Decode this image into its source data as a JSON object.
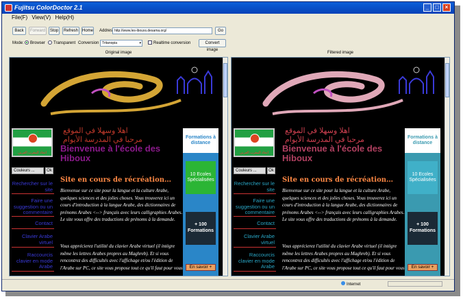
{
  "window": {
    "title": "Fujitsu ColorDoctor 2.1"
  },
  "menu": [
    "File(F)",
    "View(V)",
    "Help(H)"
  ],
  "toolbar": {
    "back": "Back",
    "forward": "Forward",
    "stop": "Stop",
    "refresh": "Refresh",
    "home": "Home",
    "address_label": "Address:",
    "address_value": "http://www.les-ibouxs.desama.org/",
    "go": "Go"
  },
  "options": {
    "mode_label": "Mode:",
    "mode_browser": "Browser",
    "mode_transparent": "Transparent",
    "filter_label": "Conversion filter:",
    "filter_value": "Tritanopia",
    "realtime": "Realtime conversion",
    "convert": "Convert image"
  },
  "panes": {
    "original_title": "Original image",
    "filtered_title": "Filtered image"
  },
  "site": {
    "arabic1": "اهلا وسهلا في الموقع",
    "arabic2": "مرحبا في المدرسة الأيوام",
    "welcome": "Bienvenue à l'école des Hiboux",
    "subhead": "Site en cours de récréation…",
    "para1": "Bienvenue sur ce site pour la langue et la culture Arabe, quelques sciences et des jolies choses. Vous trouverez ici un cours d'introduction à la langue Arabe, des dictionnaires de prénoms Arabes <--> français avec leurs calligraphies Arabes. Le site vous offre des traductions de prénoms à la demande.",
    "para2": "Vous apprécierez l'utilité du clavier Arabe virtuel (il intègre même les lettres Arabes propres au Maghreb). Et si vous rencontrez des difficultés avec l'affichage et/ou l'édition de l'Arabe sur PC, ce site vous propose tout ce qu'il faut pour vous",
    "logo_caption": "اتحاد المغرب العربي",
    "colors_select": "Couleurs ...",
    "ok": "Ok",
    "nav": [
      "Rechercher sur le site",
      "Faire une suggestion ou un commentaire",
      "Contact",
      "Clavier Arabe virtuel",
      "Raccourcis clavier en mode Arabe"
    ],
    "side_title": "Formations à distance",
    "side_schools": "10 Ecoles Spécialisées",
    "side_formations": "+ 100 Formations",
    "side_more": "En savoir +"
  },
  "status": {
    "zone": "Internet"
  },
  "colors": {
    "original": {
      "arabic": "#c0392b",
      "welcome": "#8b1a8b",
      "nav": "#3a3ad8",
      "sidebar": "#2a86c8",
      "green": "#2bb535",
      "curl": "#d4a535"
    },
    "filtered": {
      "arabic": "#d04050",
      "welcome": "#b04060",
      "nav": "#2aa8c8",
      "sidebar": "#3a9ab0",
      "green": "#40b0c8",
      "curl": "#e0a8b8"
    }
  }
}
